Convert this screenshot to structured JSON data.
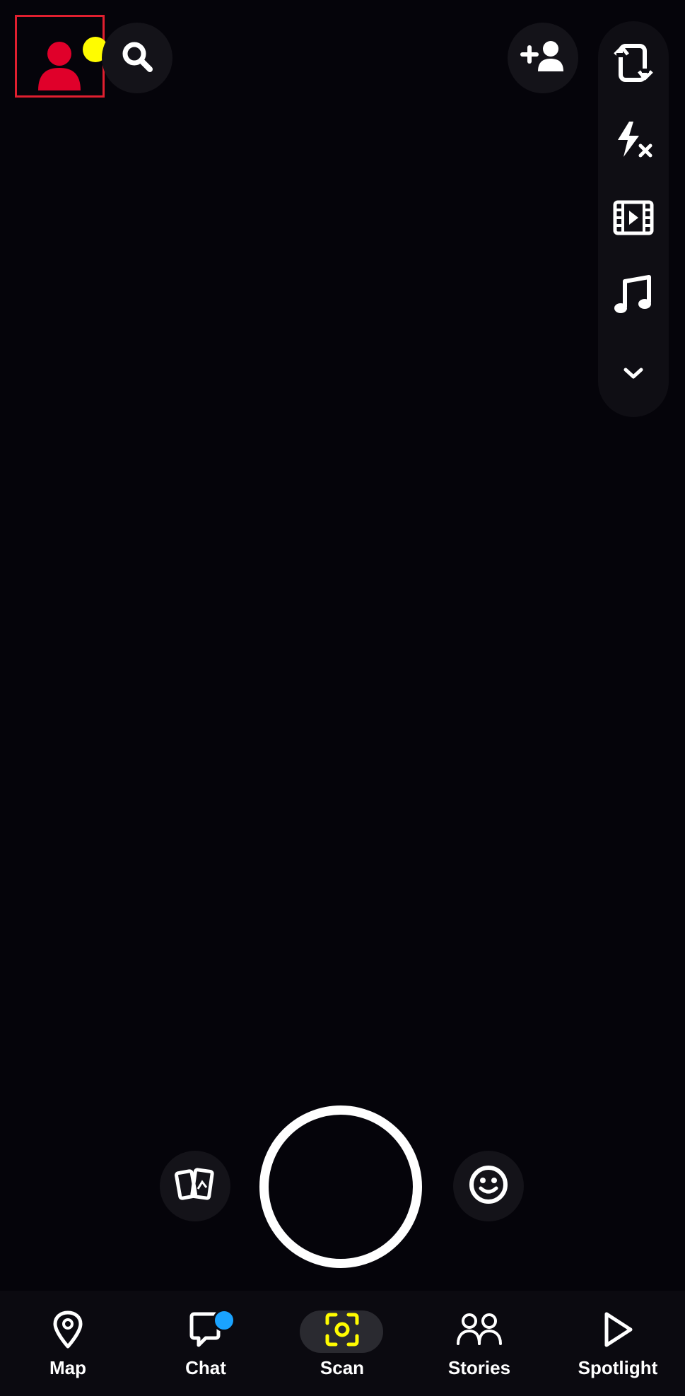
{
  "colors": {
    "background": "#05040a",
    "highlight_box": "#e01f2f",
    "avatar": "#e0002a",
    "notification_dot": "#fffc00",
    "chat_dot": "#1aa3ff",
    "scan_active": "#fffc00",
    "icon": "#ffffff"
  },
  "header": {
    "avatar_icon": "avatar-icon",
    "search_icon": "search-icon",
    "add_friend_icon": "add-friend-icon"
  },
  "tools": [
    {
      "icon": "flip-camera-icon"
    },
    {
      "icon": "flash-off-icon"
    },
    {
      "icon": "video-film-icon"
    },
    {
      "icon": "music-note-icon"
    },
    {
      "icon": "chevron-down-icon"
    }
  ],
  "camera": {
    "memories_icon": "memories-icon",
    "lens_icon": "smiley-icon"
  },
  "bottom_nav": {
    "items": [
      {
        "label": "Map",
        "icon": "map-pin-icon"
      },
      {
        "label": "Chat",
        "icon": "chat-bubble-icon"
      },
      {
        "label": "Scan",
        "icon": "scan-icon",
        "active": true
      },
      {
        "label": "Stories",
        "icon": "stories-icon"
      },
      {
        "label": "Spotlight",
        "icon": "play-icon"
      }
    ]
  }
}
